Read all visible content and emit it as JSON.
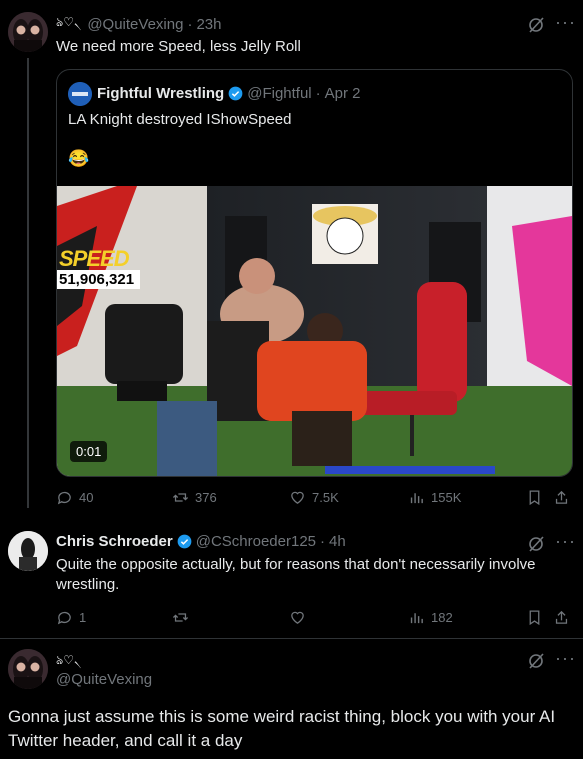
{
  "tweet1": {
    "display_name": "",
    "handle": "@QuiteVexing",
    "time": "23h",
    "text": "We need more Speed, less Jelly Roll",
    "quote": {
      "name": "Fightful Wrestling",
      "handle": "@Fightful",
      "date": "Apr 2",
      "text": "LA Knight destroyed IShowSpeed",
      "emoji": "😂",
      "video": {
        "timer": "0:01",
        "banner_text": "SPEED",
        "counter": "51,906,321"
      }
    },
    "stats": {
      "replies": "40",
      "retweets": "376",
      "likes": "7.5K",
      "views": "155K"
    }
  },
  "tweet2": {
    "name": "Chris Schroeder",
    "handle": "@CSchroeder125",
    "time": "4h",
    "text": "Quite the opposite actually, but for reasons that don't necessarily involve wrestling.",
    "stats": {
      "replies": "1",
      "views": "182"
    }
  },
  "tweet3": {
    "handle": "@QuiteVexing",
    "text": "Gonna just assume this is some weird racist thing, block you with your AI Twitter header, and call it a day"
  },
  "colors": {
    "verified": "#1d9bf0",
    "muted": "#71767b",
    "border": "#2f3336"
  }
}
